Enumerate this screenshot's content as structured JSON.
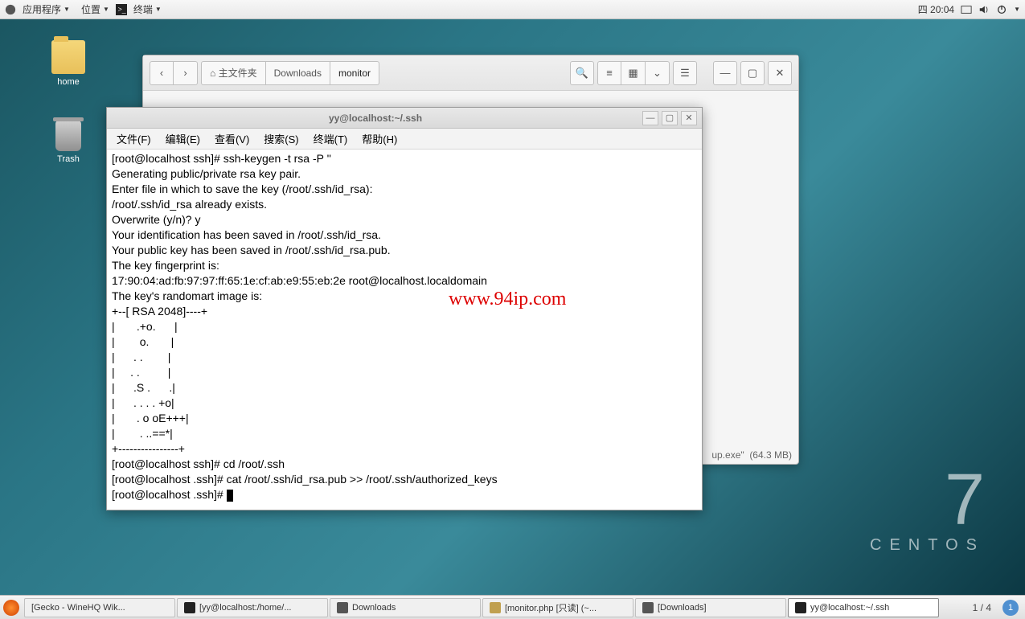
{
  "topbar": {
    "apps_label": "应用程序",
    "places_label": "位置",
    "terminal_label": "终端",
    "clock": "四 20:04"
  },
  "desktop": {
    "home_label": "home",
    "trash_label": "Trash"
  },
  "filemgr": {
    "home_label": "主文件夹",
    "crumb_downloads": "Downloads",
    "crumb_monitor": "monitor",
    "status_file": "up.exe\"",
    "status_size": "(64.3 MB)"
  },
  "terminal": {
    "title": "yy@localhost:~/.ssh",
    "menu": {
      "file": "文件(F)",
      "edit": "编辑(E)",
      "view": "查看(V)",
      "search": "搜索(S)",
      "terminal": "终端(T)",
      "help": "帮助(H)"
    },
    "line1": "[root@localhost ssh]# ssh-keygen -t rsa -P ''",
    "line2": "Generating public/private rsa key pair.",
    "line3": "Enter file in which to save the key (/root/.ssh/id_rsa):",
    "line4": "/root/.ssh/id_rsa already exists.",
    "line5": "Overwrite (y/n)? y",
    "line6": "Your identification has been saved in /root/.ssh/id_rsa.",
    "line7": "Your public key has been saved in /root/.ssh/id_rsa.pub.",
    "line8": "The key fingerprint is:",
    "line9": "17:90:04:ad:fb:97:97:ff:65:1e:cf:ab:e9:55:eb:2e root@localhost.localdomain",
    "line10": "The key's randomart image is:",
    "line11": "+--[ RSA 2048]----+",
    "line12": "|       .+o.      |",
    "line13": "|        o.       |",
    "line14": "|      . .        |",
    "line15": "|     . .         |",
    "line16": "|      .S .      .|",
    "line17": "|      . . . . +o|",
    "line18": "|       . o oE+++|",
    "line19": "|        . ..==*|",
    "line20": "+----------------+",
    "line21": "[root@localhost ssh]# cd /root/.ssh",
    "line22": "[root@localhost .ssh]# cat /root/.ssh/id_rsa.pub >> /root/.ssh/authorized_keys",
    "line23": "[root@localhost .ssh]# "
  },
  "watermark": "www.94ip.com",
  "centos": {
    "num": "7",
    "word": "CENTOS"
  },
  "taskbar": {
    "t1": "[Gecko - WineHQ Wik...",
    "t2": "[yy@localhost:/home/...",
    "t3": "Downloads",
    "t4": "[monitor.php [只读] (~...",
    "t5": "[Downloads]",
    "t6": "yy@localhost:~/.ssh",
    "workspace": "1 / 4",
    "tray_badge": "1"
  }
}
